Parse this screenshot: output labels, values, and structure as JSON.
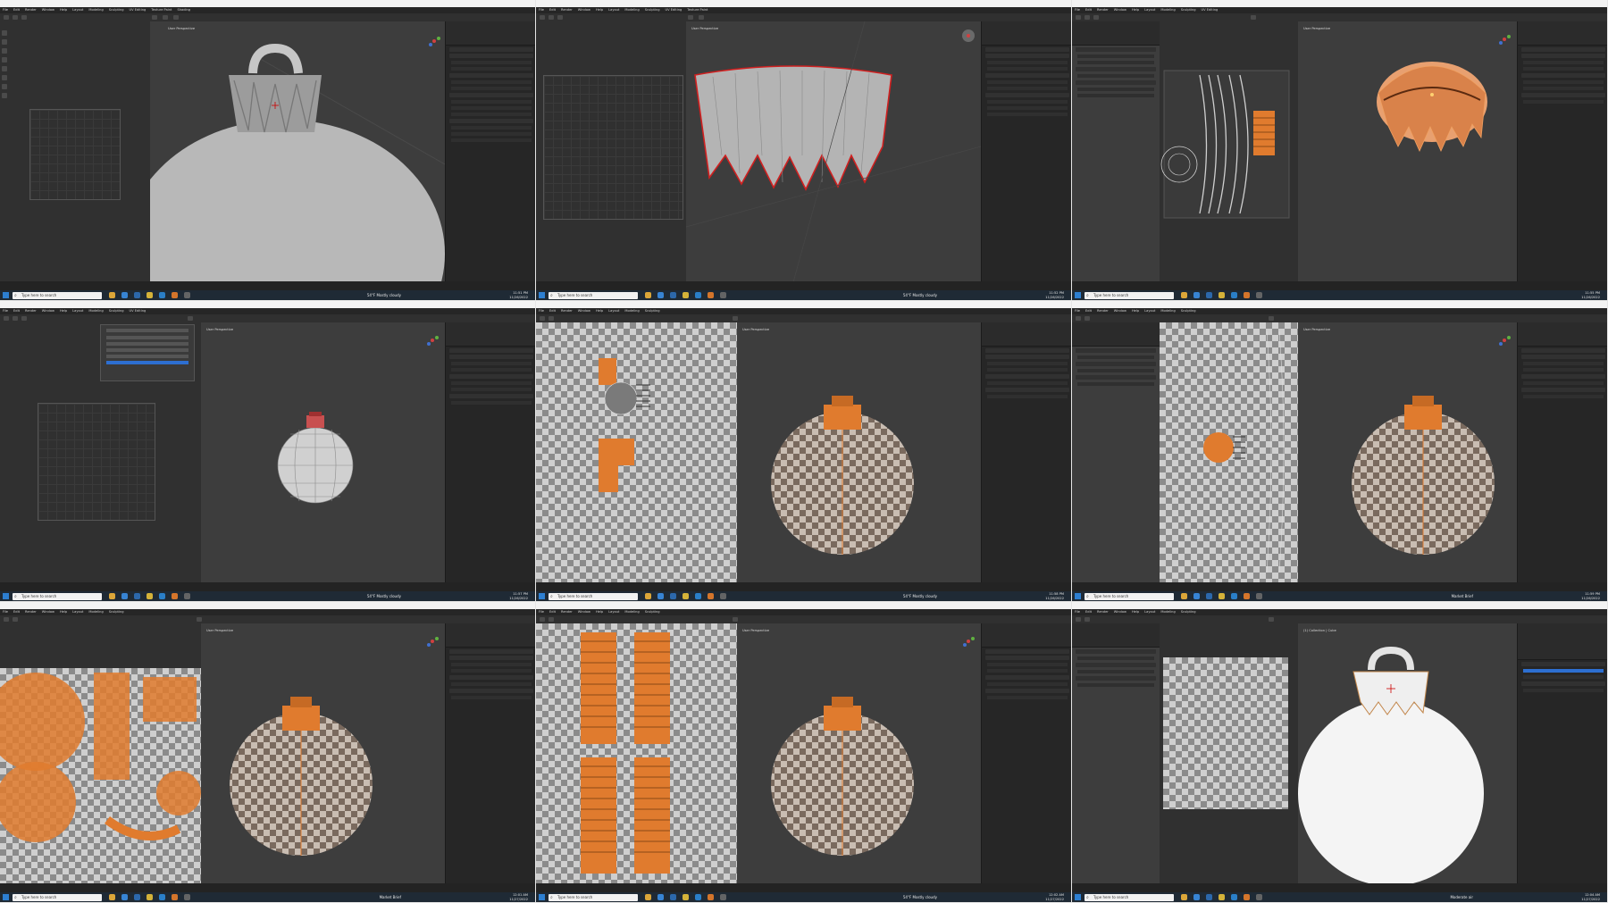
{
  "colors": {
    "viewport": "#3d3d3d",
    "uv_editor": "#303030",
    "properties": "#262626",
    "taskbar": "#1f2a35",
    "selection_orange": "#e07b2e",
    "seam_red": "#d02020",
    "mesh_grey": "#b8b8b8"
  },
  "menu_items": [
    "File",
    "Edit",
    "Render",
    "Window",
    "Help",
    "Layout",
    "Modeling",
    "Sculpting",
    "UV Editing",
    "Texture Paint",
    "Shading",
    "Animation",
    "Rendering",
    "Compositing",
    "Scripting"
  ],
  "taskbar": {
    "search_placeholder": "Type here to search",
    "icons": [
      "explorer-icon",
      "store-icon",
      "mail-icon",
      "chrome-icon",
      "vscode-icon",
      "blender-icon",
      "obs-icon"
    ]
  },
  "viewport_labels": {
    "perspective": "User Perspective",
    "collection": "(1) Collection | Cube"
  },
  "tiles": [
    {
      "id": "t1",
      "weather": "54°F Mostly cloudy",
      "clock": [
        "11:51 PM",
        "11/26/2022"
      ]
    },
    {
      "id": "t2",
      "weather": "54°F Mostly cloudy",
      "clock": [
        "11:52 PM",
        "11/26/2022"
      ]
    },
    {
      "id": "t3",
      "weather": "",
      "clock": [
        "11:55 PM",
        "11/26/2022"
      ]
    },
    {
      "id": "t4",
      "weather": "54°F Mostly cloudy",
      "clock": [
        "11:57 PM",
        "11/26/2022"
      ]
    },
    {
      "id": "t5",
      "weather": "54°F Mostly cloudy",
      "clock": [
        "11:58 PM",
        "11/26/2022"
      ]
    },
    {
      "id": "t6",
      "weather": "Market Brief",
      "clock": [
        "11:59 PM",
        "11/26/2022"
      ]
    },
    {
      "id": "t7",
      "weather": "Market Brief",
      "clock": [
        "12:01 AM",
        "11/27/2022"
      ]
    },
    {
      "id": "t8",
      "weather": "54°F Mostly cloudy",
      "clock": [
        "12:02 AM",
        "11/27/2022"
      ]
    },
    {
      "id": "t9",
      "weather": "Moderate air",
      "clock": [
        "12:04 AM",
        "11/27/2022"
      ]
    }
  ]
}
